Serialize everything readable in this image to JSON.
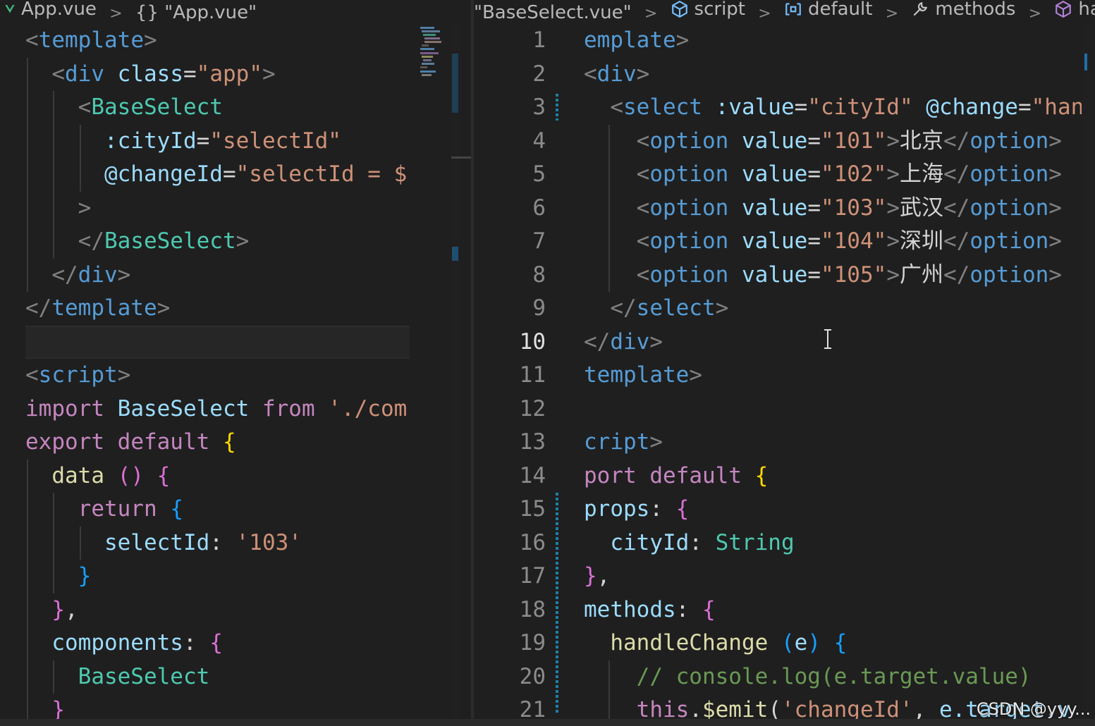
{
  "left": {
    "breadcrumb": [
      {
        "text": "App.vue",
        "icon": "vue-icon"
      },
      {
        "text": "{} \"App.vue\"",
        "icon": ""
      }
    ],
    "lines": [
      [
        [
          "punct",
          "<"
        ],
        [
          "tag",
          "template"
        ],
        [
          "punct",
          ">"
        ]
      ],
      [
        [
          "punct",
          "  <"
        ],
        [
          "tag",
          "div"
        ],
        [
          "plain",
          " "
        ],
        [
          "attr",
          "class"
        ],
        [
          "plain",
          "="
        ],
        [
          "str",
          "\"app\""
        ],
        [
          "punct",
          ">"
        ]
      ],
      [
        [
          "punct",
          "    <"
        ],
        [
          "comp",
          "BaseSelect"
        ]
      ],
      [
        [
          "plain",
          "      "
        ],
        [
          "attr",
          ":cityId"
        ],
        [
          "plain",
          "="
        ],
        [
          "str",
          "\"selectId\""
        ]
      ],
      [
        [
          "plain",
          "      "
        ],
        [
          "attr",
          "@changeId"
        ],
        [
          "plain",
          "="
        ],
        [
          "str",
          "\"selectId = $"
        ]
      ],
      [
        [
          "punct",
          "    >"
        ]
      ],
      [
        [
          "punct",
          "    </"
        ],
        [
          "comp",
          "BaseSelect"
        ],
        [
          "punct",
          ">"
        ]
      ],
      [
        [
          "punct",
          "  </"
        ],
        [
          "tag",
          "div"
        ],
        [
          "punct",
          ">"
        ]
      ],
      [
        [
          "punct",
          "</"
        ],
        [
          "tag",
          "template"
        ],
        [
          "punct",
          ">"
        ]
      ],
      [
        [
          "plain",
          ""
        ]
      ],
      [
        [
          "punct",
          "<"
        ],
        [
          "tag",
          "script"
        ],
        [
          "punct",
          ">"
        ]
      ],
      [
        [
          "kw",
          "import"
        ],
        [
          "plain",
          " "
        ],
        [
          "var",
          "BaseSelect"
        ],
        [
          "plain",
          " "
        ],
        [
          "kw",
          "from"
        ],
        [
          "plain",
          " "
        ],
        [
          "str",
          "'./com"
        ]
      ],
      [
        [
          "kw",
          "export"
        ],
        [
          "plain",
          " "
        ],
        [
          "kw",
          "default"
        ],
        [
          "plain",
          " "
        ],
        [
          "b1",
          "{"
        ]
      ],
      [
        [
          "plain",
          "  "
        ],
        [
          "fn",
          "data"
        ],
        [
          "plain",
          " "
        ],
        [
          "b2",
          "()"
        ],
        [
          "plain",
          " "
        ],
        [
          "b2",
          "{"
        ]
      ],
      [
        [
          "plain",
          "    "
        ],
        [
          "kw",
          "return"
        ],
        [
          "plain",
          " "
        ],
        [
          "b3",
          "{"
        ]
      ],
      [
        [
          "plain",
          "      "
        ],
        [
          "var",
          "selectId"
        ],
        [
          "plain",
          ": "
        ],
        [
          "str",
          "'103'"
        ]
      ],
      [
        [
          "plain",
          "    "
        ],
        [
          "b3",
          "}"
        ]
      ],
      [
        [
          "plain",
          "  "
        ],
        [
          "b2",
          "}"
        ],
        [
          "plain",
          ","
        ]
      ],
      [
        [
          "plain",
          "  "
        ],
        [
          "var",
          "components"
        ],
        [
          "plain",
          ": "
        ],
        [
          "b2",
          "{"
        ]
      ],
      [
        [
          "plain",
          "    "
        ],
        [
          "type",
          "BaseSelect"
        ]
      ],
      [
        [
          "plain",
          "  "
        ],
        [
          "b2",
          "}"
        ]
      ]
    ]
  },
  "right": {
    "breadcrumb": [
      {
        "text": "\"BaseSelect.vue\"",
        "icon": ""
      },
      {
        "text": "script",
        "icon": "cube-icon"
      },
      {
        "text": "default",
        "icon": "module-icon"
      },
      {
        "text": "methods",
        "icon": "wrench-icon"
      },
      {
        "text": "handleCh",
        "icon": "cube-icon"
      }
    ],
    "line_numbers": [
      "1",
      "2",
      "3",
      "4",
      "5",
      "6",
      "7",
      "8",
      "9",
      "10",
      "11",
      "12",
      "13",
      "14",
      "15",
      "16",
      "17",
      "18",
      "19",
      "20",
      "21"
    ],
    "current_line": "10",
    "lines": [
      [
        [
          "tag",
          "emplate"
        ],
        [
          "punct",
          ">"
        ]
      ],
      [
        [
          "punct",
          "<"
        ],
        [
          "tag",
          "div"
        ],
        [
          "punct",
          ">"
        ]
      ],
      [
        [
          "punct",
          "  <"
        ],
        [
          "tag",
          "select"
        ],
        [
          "plain",
          " "
        ],
        [
          "attr",
          ":value"
        ],
        [
          "plain",
          "="
        ],
        [
          "str",
          "\"cityId\""
        ],
        [
          "plain",
          " "
        ],
        [
          "attr",
          "@change"
        ],
        [
          "plain",
          "="
        ],
        [
          "str",
          "\"han"
        ]
      ],
      [
        [
          "punct",
          "    <"
        ],
        [
          "tag",
          "option"
        ],
        [
          "plain",
          " "
        ],
        [
          "attr",
          "value"
        ],
        [
          "plain",
          "="
        ],
        [
          "str",
          "\"101\""
        ],
        [
          "punct",
          ">"
        ],
        [
          "plain",
          "北京"
        ],
        [
          "punct",
          "</"
        ],
        [
          "tag",
          "option"
        ],
        [
          "punct",
          ">"
        ]
      ],
      [
        [
          "punct",
          "    <"
        ],
        [
          "tag",
          "option"
        ],
        [
          "plain",
          " "
        ],
        [
          "attr",
          "value"
        ],
        [
          "plain",
          "="
        ],
        [
          "str",
          "\"102\""
        ],
        [
          "punct",
          ">"
        ],
        [
          "plain",
          "上海"
        ],
        [
          "punct",
          "</"
        ],
        [
          "tag",
          "option"
        ],
        [
          "punct",
          ">"
        ]
      ],
      [
        [
          "punct",
          "    <"
        ],
        [
          "tag",
          "option"
        ],
        [
          "plain",
          " "
        ],
        [
          "attr",
          "value"
        ],
        [
          "plain",
          "="
        ],
        [
          "str",
          "\"103\""
        ],
        [
          "punct",
          ">"
        ],
        [
          "plain",
          "武汉"
        ],
        [
          "punct",
          "</"
        ],
        [
          "tag",
          "option"
        ],
        [
          "punct",
          ">"
        ]
      ],
      [
        [
          "punct",
          "    <"
        ],
        [
          "tag",
          "option"
        ],
        [
          "plain",
          " "
        ],
        [
          "attr",
          "value"
        ],
        [
          "plain",
          "="
        ],
        [
          "str",
          "\"104\""
        ],
        [
          "punct",
          ">"
        ],
        [
          "plain",
          "深圳"
        ],
        [
          "punct",
          "</"
        ],
        [
          "tag",
          "option"
        ],
        [
          "punct",
          ">"
        ]
      ],
      [
        [
          "punct",
          "    <"
        ],
        [
          "tag",
          "option"
        ],
        [
          "plain",
          " "
        ],
        [
          "attr",
          "value"
        ],
        [
          "plain",
          "="
        ],
        [
          "str",
          "\"105\""
        ],
        [
          "punct",
          ">"
        ],
        [
          "plain",
          "广州"
        ],
        [
          "punct",
          "</"
        ],
        [
          "tag",
          "option"
        ],
        [
          "punct",
          ">"
        ]
      ],
      [
        [
          "punct",
          "  </"
        ],
        [
          "tag",
          "select"
        ],
        [
          "punct",
          ">"
        ]
      ],
      [
        [
          "punct",
          "</"
        ],
        [
          "tag",
          "div"
        ],
        [
          "punct",
          ">"
        ]
      ],
      [
        [
          "tag",
          "template"
        ],
        [
          "punct",
          ">"
        ]
      ],
      [
        [
          "plain",
          ""
        ]
      ],
      [
        [
          "tag",
          "cript"
        ],
        [
          "punct",
          ">"
        ]
      ],
      [
        [
          "kw",
          "port"
        ],
        [
          "plain",
          " "
        ],
        [
          "kw",
          "default"
        ],
        [
          "plain",
          " "
        ],
        [
          "b1",
          "{"
        ]
      ],
      [
        [
          "var",
          "props"
        ],
        [
          "plain",
          ": "
        ],
        [
          "b2",
          "{"
        ]
      ],
      [
        [
          "plain",
          "  "
        ],
        [
          "var",
          "cityId"
        ],
        [
          "plain",
          ": "
        ],
        [
          "type",
          "String"
        ]
      ],
      [
        [
          "b2",
          "}"
        ],
        [
          "plain",
          ","
        ]
      ],
      [
        [
          "var",
          "methods"
        ],
        [
          "plain",
          ": "
        ],
        [
          "b2",
          "{"
        ]
      ],
      [
        [
          "plain",
          "  "
        ],
        [
          "fn",
          "handleChange"
        ],
        [
          "plain",
          " "
        ],
        [
          "b3",
          "("
        ],
        [
          "var",
          "e"
        ],
        [
          "b3",
          ")"
        ],
        [
          "plain",
          " "
        ],
        [
          "b3",
          "{"
        ]
      ],
      [
        [
          "plain",
          "    "
        ],
        [
          "comment",
          "// console.log(e.target.value)"
        ]
      ],
      [
        [
          "plain",
          "    "
        ],
        [
          "kw",
          "this"
        ],
        [
          "plain",
          "."
        ],
        [
          "fn",
          "$emit"
        ],
        [
          "plain",
          "("
        ],
        [
          "str",
          "'changeId'"
        ],
        [
          "plain",
          ", "
        ],
        [
          "var",
          "e.target.v"
        ]
      ]
    ]
  },
  "watermark": "CSDN @yyy..."
}
